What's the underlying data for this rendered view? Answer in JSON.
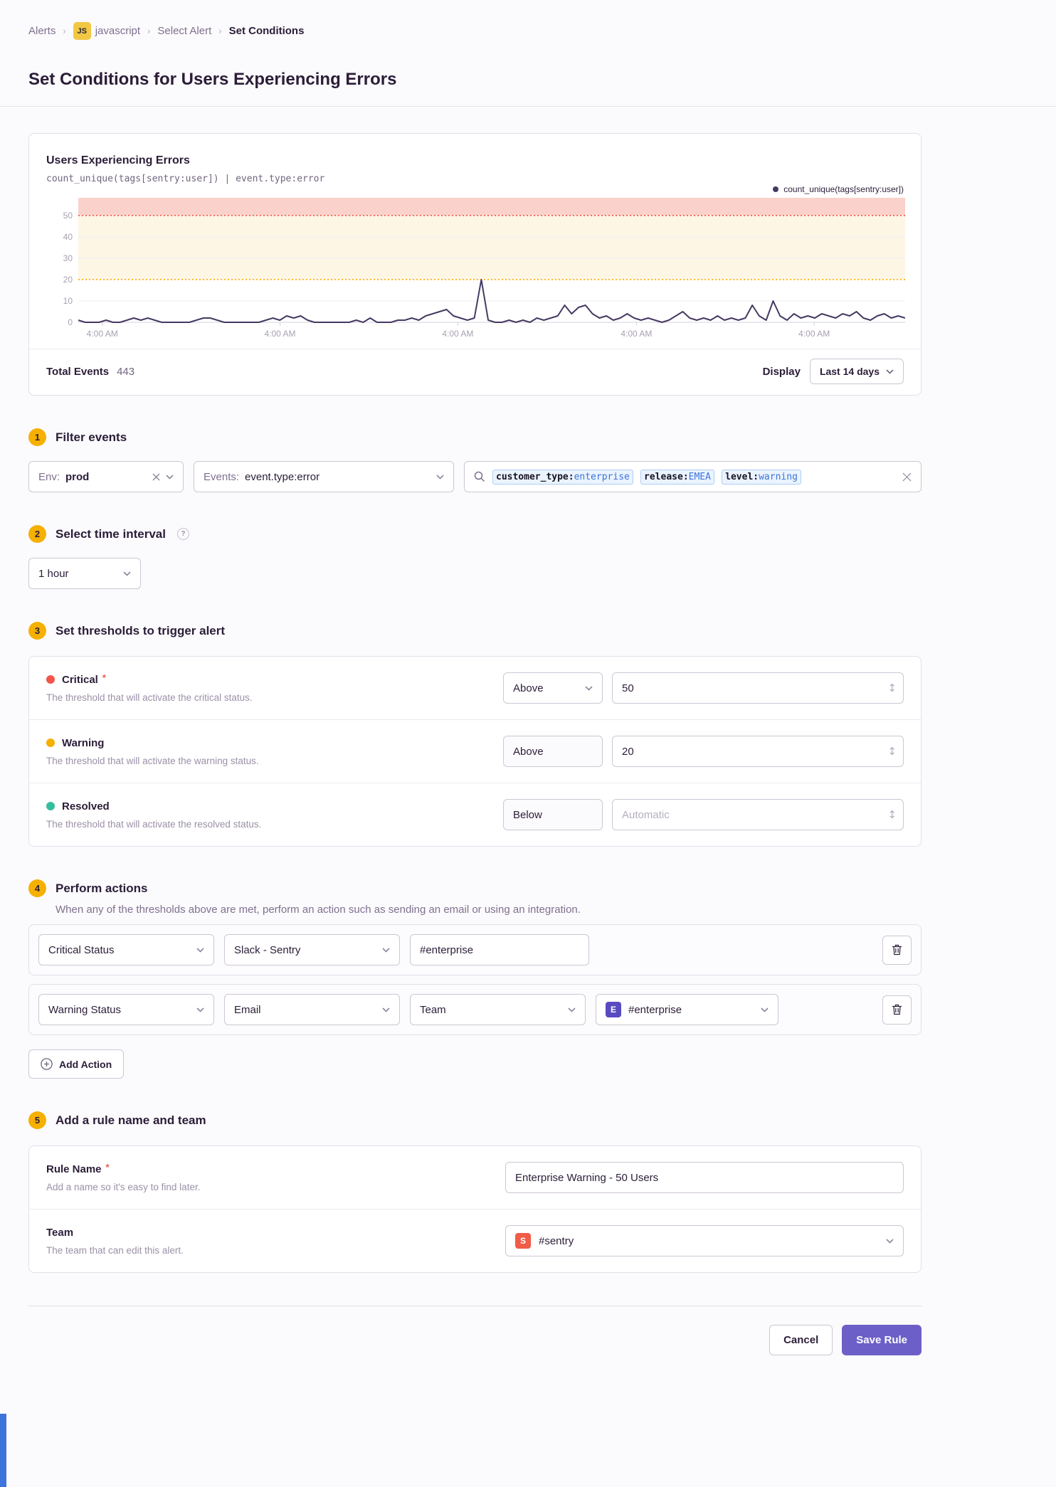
{
  "colors": {
    "accent": "#6C5FC7",
    "step_badge": "#F5B000",
    "critical": "#F55549",
    "warning": "#F5B000",
    "resolved": "#33BF9E",
    "project_badge": "#F2C744",
    "left_accent": "#3D74DB"
  },
  "icons": {
    "help": "?",
    "stepper": "↕"
  },
  "breadcrumb": {
    "items": [
      {
        "label": "Alerts"
      },
      {
        "label": "javascript",
        "badge": "JS"
      },
      {
        "label": "Select Alert"
      },
      {
        "label": "Set Conditions"
      }
    ]
  },
  "page": {
    "title": "Set Conditions for Users Experiencing Errors"
  },
  "chart_panel": {
    "title": "Users Experiencing Errors",
    "query": "count_unique(tags[sentry:user]) | event.type:error",
    "legend": "count_unique(tags[sentry:user])",
    "total_events_label": "Total Events",
    "total_events_value": "443",
    "display_label": "Display",
    "display_value": "Last 14 days"
  },
  "chart_data": {
    "type": "line",
    "title": "Users Experiencing Errors",
    "series": [
      {
        "name": "count_unique(tags[sentry:user])",
        "values": [
          1,
          0,
          0,
          0,
          1,
          0,
          0,
          1,
          2,
          1,
          2,
          1,
          0,
          0,
          0,
          0,
          0,
          1,
          2,
          2,
          1,
          0,
          0,
          0,
          0,
          0,
          0,
          1,
          2,
          1,
          3,
          2,
          3,
          1,
          0,
          0,
          0,
          0,
          0,
          0,
          1,
          0,
          2,
          0,
          0,
          0,
          1,
          1,
          2,
          1,
          3,
          4,
          5,
          6,
          3,
          2,
          1,
          2,
          20,
          1,
          0,
          0,
          1,
          0,
          1,
          0,
          2,
          1,
          2,
          3,
          8,
          4,
          7,
          8,
          4,
          2,
          3,
          1,
          2,
          4,
          2,
          1,
          2,
          1,
          0,
          1,
          3,
          5,
          2,
          1,
          2,
          1,
          3,
          1,
          2,
          1,
          2,
          8,
          3,
          1,
          10,
          3,
          1,
          4,
          2,
          3,
          2,
          4,
          3,
          2,
          4,
          3,
          5,
          2,
          1,
          3,
          4,
          2,
          3,
          2
        ]
      }
    ],
    "x_tick_labels": [
      "4:00 AM",
      "4:00 AM",
      "4:00 AM",
      "4:00 AM",
      "4:00 AM"
    ],
    "x_tick_fractions": [
      0.029,
      0.244,
      0.459,
      0.675,
      0.89
    ],
    "y_ticks": [
      0,
      10,
      20,
      30,
      40,
      50
    ],
    "ylim": [
      0,
      58.3
    ],
    "grid": true,
    "legend_position": "top-right",
    "thresholds": {
      "critical": 50,
      "warning": 20
    },
    "chart_colors": {
      "series": "#453962",
      "critical_line": "#F55549",
      "critical_band": "#FAD2CB",
      "warning_line": "#FFAA00",
      "warning_band": "#FDF6E4",
      "grid": "#EFECF3",
      "axis": "#D6D0DC",
      "tick_text": "#A8A0B1"
    }
  },
  "steps": {
    "filter": {
      "number": "1",
      "title": "Filter events",
      "env_label": "Env:",
      "env_value": "prod",
      "events_label": "Events:",
      "events_value": "event.type:error",
      "search_tokens": [
        {
          "key": "customer_type:",
          "value": "enterprise"
        },
        {
          "key": "release:",
          "value": "EMEA"
        },
        {
          "key": "level:",
          "value": "warning"
        }
      ]
    },
    "interval": {
      "number": "2",
      "title": "Select time interval",
      "value": "1 hour"
    },
    "thresholds": {
      "number": "3",
      "title": "Set thresholds to trigger alert",
      "rows": [
        {
          "label": "Critical",
          "required_marker": "*",
          "dot_color": "#F55549",
          "description": "The threshold that will activate the critical status.",
          "comparison": "Above",
          "value": "50",
          "placeholder": ""
        },
        {
          "label": "Warning",
          "required_marker": "",
          "dot_color": "#F5B000",
          "description": "The threshold that will activate the warning status.",
          "comparison": "Above",
          "value": "20",
          "placeholder": ""
        },
        {
          "label": "Resolved",
          "required_marker": "",
          "dot_color": "#33BF9E",
          "description": "The threshold that will activate the resolved status.",
          "comparison": "Below",
          "value": "",
          "placeholder": "Automatic"
        }
      ]
    },
    "actions": {
      "number": "4",
      "title": "Perform actions",
      "description": "When any of the thresholds above are met, perform an action such as sending an email or using an integration.",
      "rows": [
        {
          "status": "Critical Status",
          "service": "Slack - Sentry",
          "target_input": "#enterprise"
        },
        {
          "status": "Warning Status",
          "service": "Email",
          "target_type": "Team",
          "target_value": "#enterprise",
          "target_avatar": "E",
          "target_avatar_color": "#584AC0"
        }
      ],
      "add_action_label": "Add Action"
    },
    "name": {
      "number": "5",
      "title": "Add a rule name and team",
      "rule_name_label": "Rule Name",
      "required_marker": "*",
      "rule_name_description": "Add a name so it's easy to find later.",
      "rule_name_value": "Enterprise Warning - 50 Users",
      "team_label": "Team",
      "team_description": "The team that can edit this alert.",
      "team_value": "#sentry",
      "team_avatar": "S",
      "team_avatar_color": "#F05C48"
    }
  },
  "footer": {
    "cancel_label": "Cancel",
    "save_label": "Save Rule"
  }
}
